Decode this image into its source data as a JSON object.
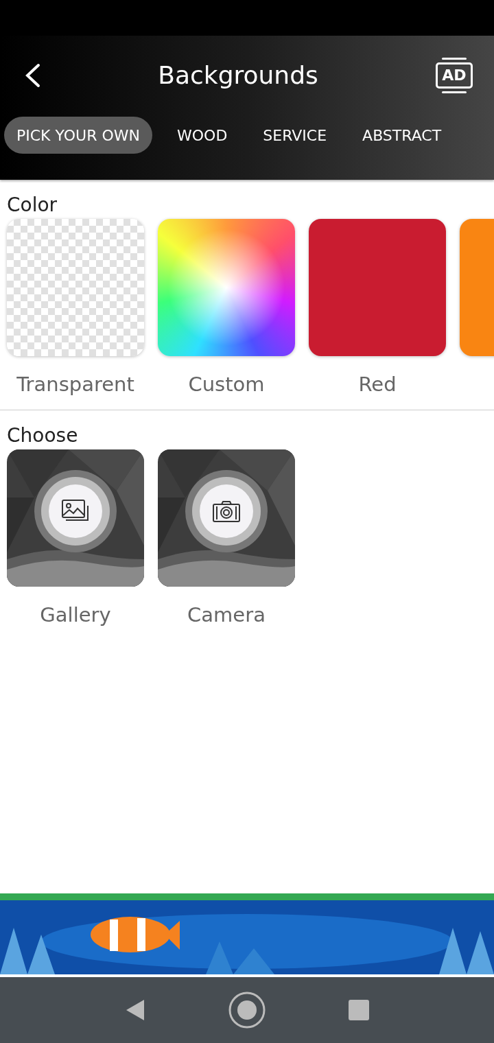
{
  "header": {
    "title": "Backgrounds",
    "ad_button": {
      "label": "AD"
    }
  },
  "tabs": [
    {
      "label": "PICK YOUR OWN",
      "selected": true
    },
    {
      "label": "WOOD",
      "selected": false
    },
    {
      "label": "SERVICE",
      "selected": false
    },
    {
      "label": "ABSTRACT",
      "selected": false
    }
  ],
  "color_section": {
    "title": "Color",
    "swatches": [
      {
        "kind": "transparent",
        "label": "Transparent"
      },
      {
        "kind": "spectrum",
        "label": "Custom"
      },
      {
        "kind": "solid",
        "label": "Red",
        "color": "#c91c30"
      },
      {
        "kind": "solid",
        "color": "#f98512"
      }
    ]
  },
  "choose_section": {
    "title": "Choose",
    "sources": [
      {
        "kind": "gallery",
        "label": "Gallery"
      },
      {
        "kind": "camera",
        "label": "Camera"
      }
    ]
  }
}
